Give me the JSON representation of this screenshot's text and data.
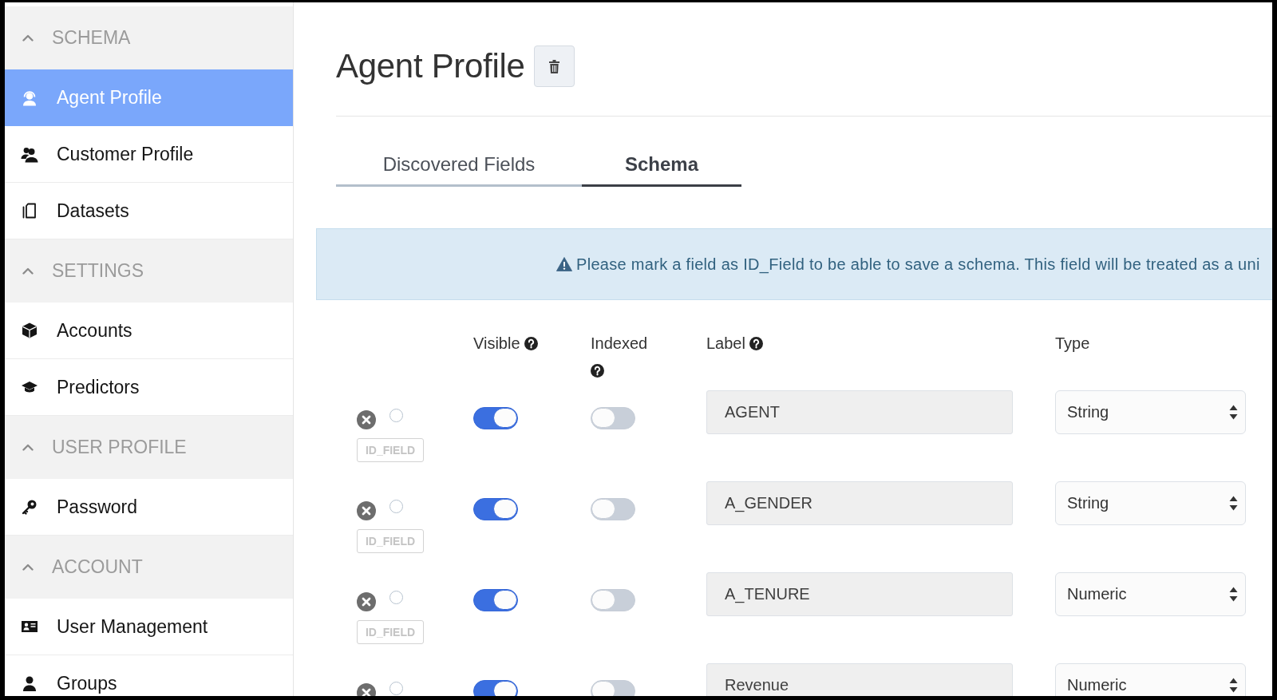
{
  "sidebar": {
    "sections": [
      {
        "title": "SCHEMA",
        "expanded": true,
        "items": [
          {
            "label": "Agent Profile",
            "selected": true
          },
          {
            "label": "Customer Profile",
            "selected": false
          },
          {
            "label": "Datasets",
            "selected": false
          }
        ]
      },
      {
        "title": "SETTINGS",
        "expanded": true,
        "items": [
          {
            "label": "Accounts",
            "selected": false
          },
          {
            "label": "Predictors",
            "selected": false
          }
        ]
      },
      {
        "title": "USER PROFILE",
        "expanded": true,
        "items": [
          {
            "label": "Password",
            "selected": false
          }
        ]
      },
      {
        "title": "ACCOUNT",
        "expanded": true,
        "items": [
          {
            "label": "User Management",
            "selected": false
          },
          {
            "label": "Groups",
            "selected": false
          }
        ]
      }
    ]
  },
  "header": {
    "title": "Agent Profile"
  },
  "tabs": [
    {
      "label": "Discovered Fields",
      "selected": false
    },
    {
      "label": "Schema",
      "selected": true
    }
  ],
  "alert": {
    "text": "Please mark a field as ID_Field to be able to save a schema. This field will be treated as a uni"
  },
  "table": {
    "columns": [
      {
        "label": "Visible",
        "help": true
      },
      {
        "label": "Indexed",
        "help": true
      },
      {
        "label": "Label",
        "help": true
      },
      {
        "label": "Type",
        "help": false
      }
    ],
    "rows": [
      {
        "selected": false,
        "tag": "ID_FIELD",
        "visible": true,
        "indexed": false,
        "label": "AGENT",
        "type": "String"
      },
      {
        "selected": false,
        "tag": "ID_FIELD",
        "visible": true,
        "indexed": false,
        "label": "A_GENDER",
        "type": "String"
      },
      {
        "selected": false,
        "tag": "ID_FIELD",
        "visible": true,
        "indexed": false,
        "label": "A_TENURE",
        "type": "Numeric"
      },
      {
        "selected": false,
        "visible": true,
        "indexed": false,
        "label": "Revenue",
        "type": "Numeric"
      }
    ]
  }
}
